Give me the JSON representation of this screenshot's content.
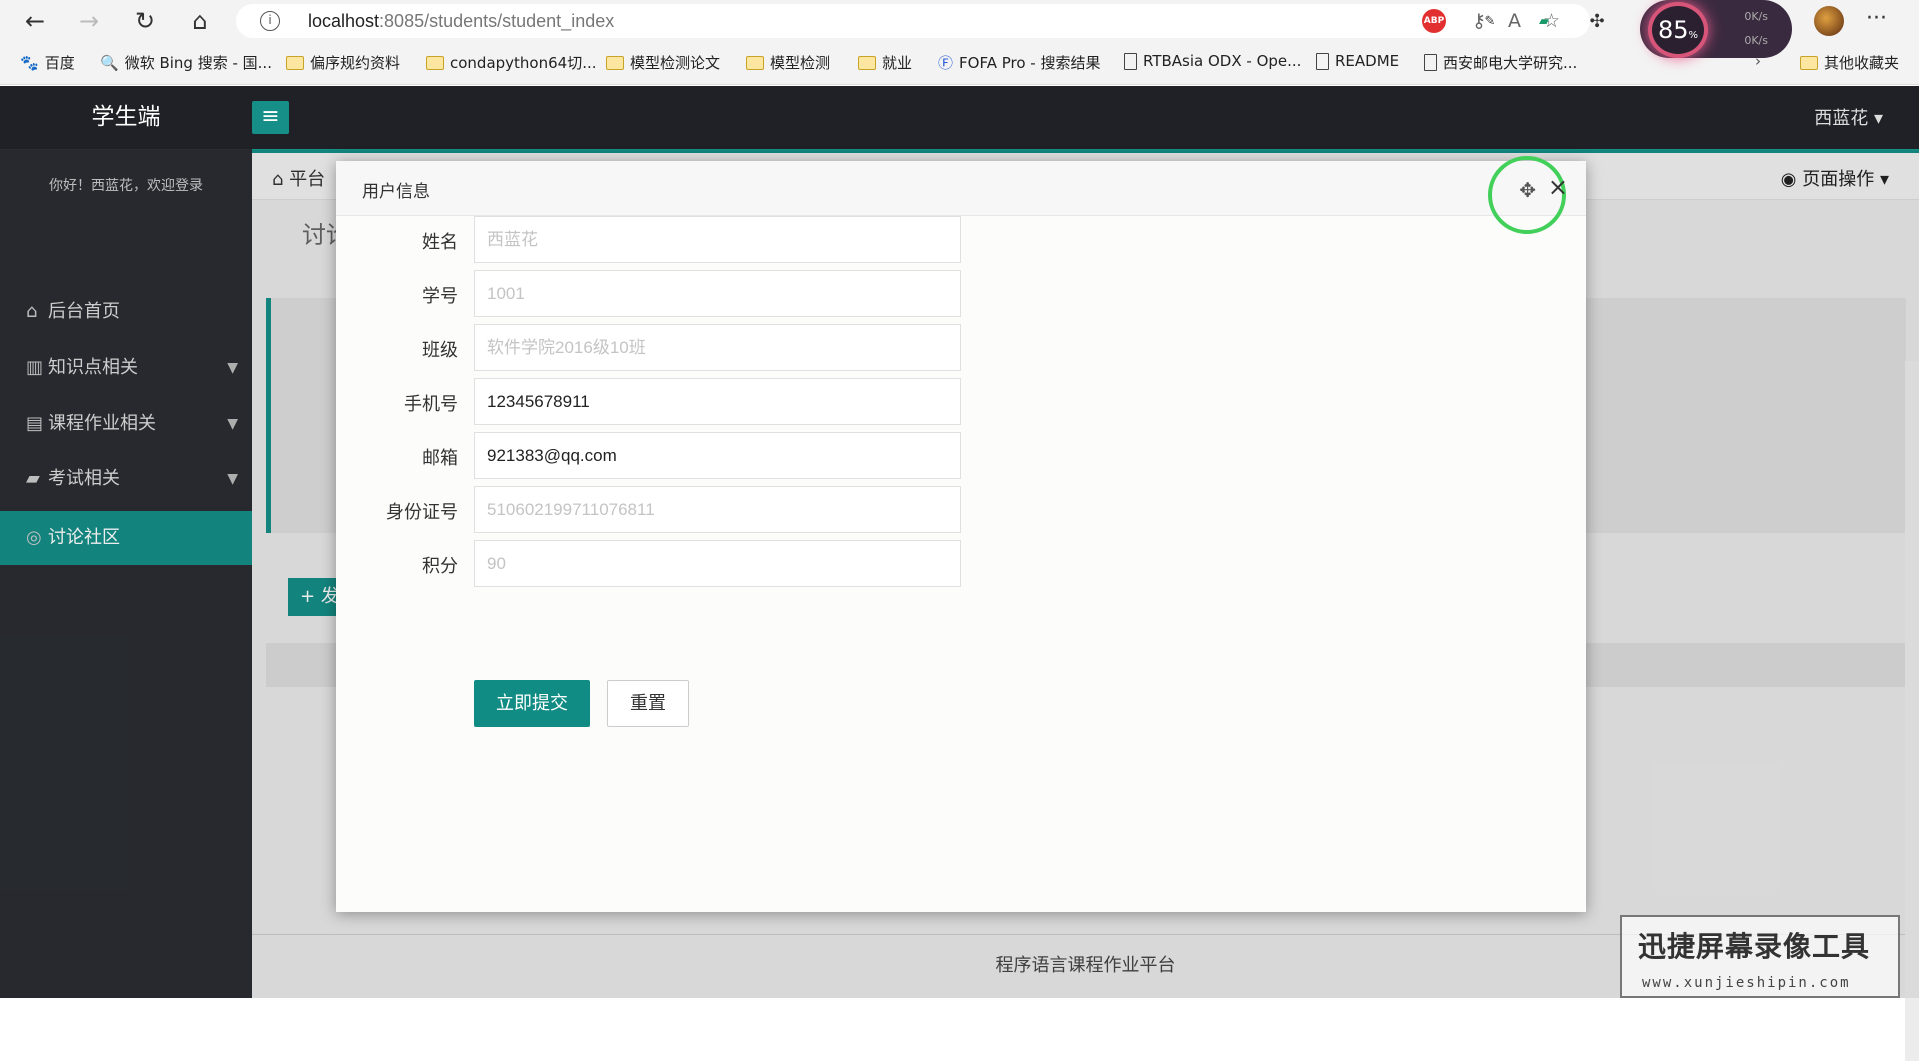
{
  "browser": {
    "url_host": "localhost",
    "url_port_path": ":8085/students/student_index",
    "bookmarks": [
      {
        "label": "百度",
        "icon": "baidu-icon"
      },
      {
        "label": "微软 Bing 搜索 - 国...",
        "icon": "search-icon"
      },
      {
        "label": "偏序规约资料",
        "icon": "folder-icon"
      },
      {
        "label": "condapython64切...",
        "icon": "folder-icon"
      },
      {
        "label": "模型检测论文",
        "icon": "folder-icon"
      },
      {
        "label": "模型检测",
        "icon": "folder-icon"
      },
      {
        "label": "就业",
        "icon": "folder-icon"
      },
      {
        "label": "FOFA Pro - 搜索结果",
        "icon": "fofa-icon"
      },
      {
        "label": "RTBAsia ODX - Ope...",
        "icon": "page-icon"
      },
      {
        "label": "README",
        "icon": "page-icon"
      },
      {
        "label": "西安邮电大学研究...",
        "icon": "page-icon"
      }
    ],
    "other_bookmarks": "其他收藏夹",
    "extension_abp": "ABP",
    "speed_percent": "85",
    "speed_up": "0K/s",
    "speed_down": "0K/s"
  },
  "app": {
    "brand": "学生端",
    "user_name": "西蓝花",
    "welcome": "你好！西蓝花，欢迎登录",
    "sidebar": [
      {
        "label": "后台首页",
        "icon": "home-icon"
      },
      {
        "label": "知识点相关",
        "icon": "book-icon"
      },
      {
        "label": "课程作业相关",
        "icon": "document-icon"
      },
      {
        "label": "考试相关",
        "icon": "exam-icon"
      },
      {
        "label": "讨论社区",
        "icon": "chat-icon"
      }
    ],
    "breadcrumb": "平台",
    "page_ops": "页面操作",
    "panel_title": "讨论",
    "add_button": "+ 发",
    "footer": "程序语言课程作业平台"
  },
  "modal": {
    "title": "用户信息",
    "fields": [
      {
        "label": "姓名",
        "placeholder": "西蓝花",
        "value": ""
      },
      {
        "label": "学号",
        "placeholder": "1001",
        "value": ""
      },
      {
        "label": "班级",
        "placeholder": "软件学院2016级10班",
        "value": ""
      },
      {
        "label": "手机号",
        "placeholder": "",
        "value": "12345678911"
      },
      {
        "label": "邮箱",
        "placeholder": "",
        "value": "921383@qq.com"
      },
      {
        "label": "身份证号",
        "placeholder": "510602199711076811",
        "value": ""
      },
      {
        "label": "积分",
        "placeholder": "90",
        "value": ""
      }
    ],
    "submit": "立即提交",
    "reset": "重置"
  },
  "watermark": {
    "title": "迅捷屏幕录像工具",
    "sub": "www.xunjieshipin.com"
  },
  "colors": {
    "accent": "#158f87",
    "topbar": "#1f2126",
    "sidebar": "#2a2d33"
  }
}
